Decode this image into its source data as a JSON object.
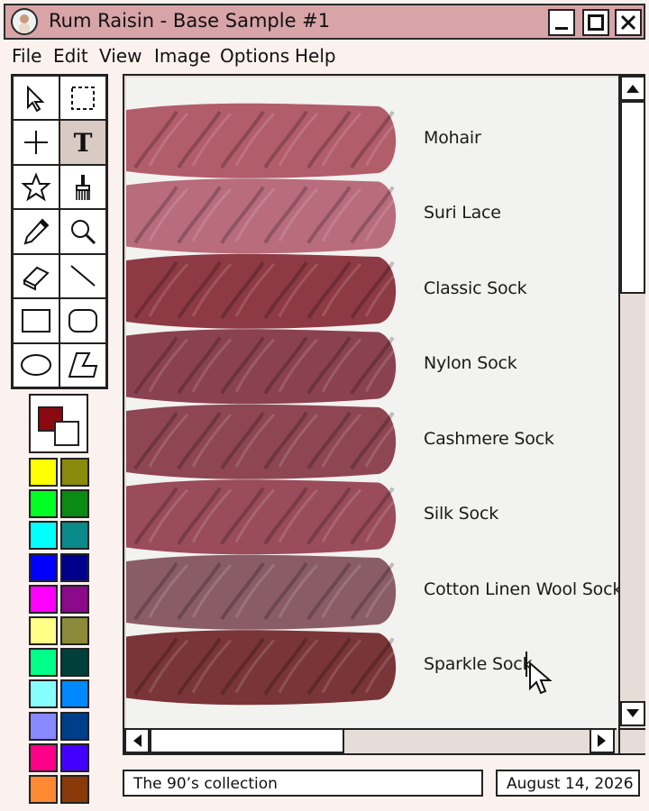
{
  "window": {
    "title": "Rum Raisin - Base Sample #1"
  },
  "menu": [
    "File",
    "Edit",
    "View",
    "Image",
    "Options",
    "Help"
  ],
  "tools": [
    {
      "name": "select-arrow-tool",
      "icon": "arrow-cursor-icon"
    },
    {
      "name": "marquee-select-tool",
      "icon": "dashed-rect-icon"
    },
    {
      "name": "crosshair-tool",
      "icon": "crosshair-icon"
    },
    {
      "name": "text-tool",
      "icon": "text-t-icon",
      "glyph": "T",
      "active": true
    },
    {
      "name": "star-tool",
      "icon": "star-icon"
    },
    {
      "name": "brush-tool",
      "icon": "brush-icon"
    },
    {
      "name": "pencil-tool",
      "icon": "pencil-icon"
    },
    {
      "name": "zoom-tool",
      "icon": "magnifier-icon"
    },
    {
      "name": "eraser-tool",
      "icon": "eraser-icon"
    },
    {
      "name": "line-tool",
      "icon": "line-icon"
    },
    {
      "name": "rectangle-tool",
      "icon": "rectangle-icon"
    },
    {
      "name": "rounded-rect-tool",
      "icon": "rounded-rect-icon"
    },
    {
      "name": "ellipse-tool",
      "icon": "ellipse-icon"
    },
    {
      "name": "polygon-tool",
      "icon": "polygon-icon"
    }
  ],
  "colors": {
    "foreground": "#8b0a10",
    "background": "#ffffff",
    "palette": [
      [
        "#ffff00",
        "#8a8a0c"
      ],
      [
        "#00ff22",
        "#0b8a14"
      ],
      [
        "#00ffff",
        "#0a8a8a"
      ],
      [
        "#0000ff",
        "#00008a"
      ],
      [
        "#ff00ff",
        "#8a0a8a"
      ],
      [
        "#ffff88",
        "#8a8a3a"
      ],
      [
        "#00ff88",
        "#003f3a"
      ],
      [
        "#88ffff",
        "#0088ff"
      ],
      [
        "#8888ff",
        "#003e8a"
      ],
      [
        "#ff0088",
        "#4400ff"
      ],
      [
        "#ff8833",
        "#8a3a0a"
      ]
    ]
  },
  "yarns": [
    {
      "label": "Mohair",
      "color": "#b25d6a"
    },
    {
      "label": "Suri Lace",
      "color": "#b86c7c"
    },
    {
      "label": "Classic Sock",
      "color": "#8e3a45"
    },
    {
      "label": "Nylon Sock",
      "color": "#8b4250"
    },
    {
      "label": "Cashmere Sock",
      "color": "#8e4653"
    },
    {
      "label": "Silk Sock",
      "color": "#9a4c5b"
    },
    {
      "label": "Cotton Linen Wool Sock",
      "color": "#8a5d66"
    },
    {
      "label": "Sparkle Sock",
      "color": "#7a3538"
    }
  ],
  "status": {
    "left": "The 90’s collection",
    "right": "August 14, 2026"
  }
}
